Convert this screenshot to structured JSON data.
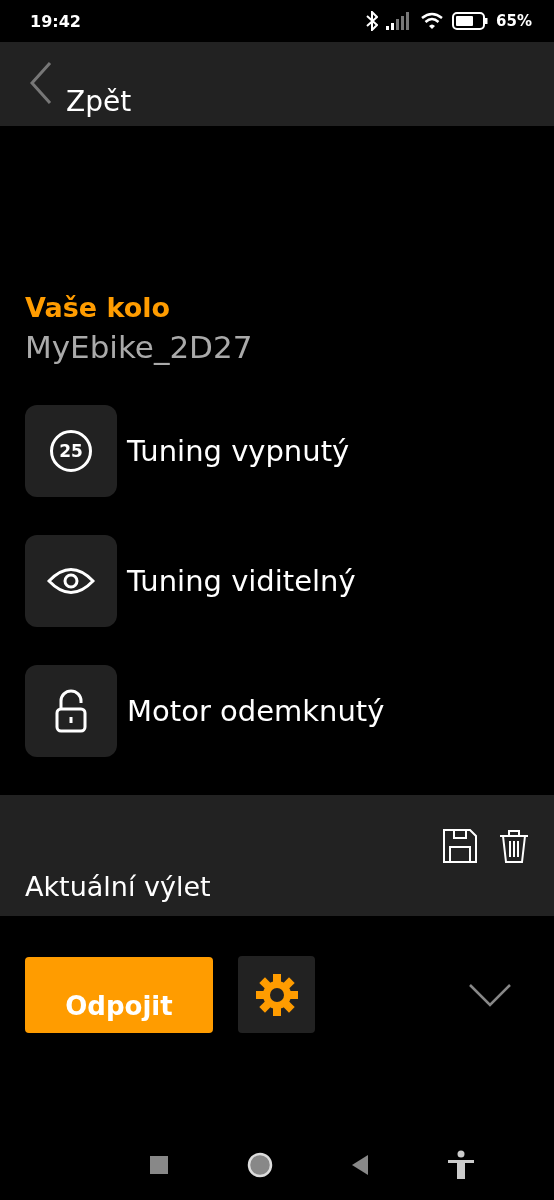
{
  "status_bar": {
    "time": "19:42",
    "battery": "65%"
  },
  "header": {
    "back_label": "Zpět"
  },
  "bike": {
    "heading": "Vaše kolo",
    "name": "MyEbike_2D27"
  },
  "features": [
    {
      "kind": "speed",
      "icon_text": "25",
      "label": "Tuning vypnutý"
    },
    {
      "kind": "eye",
      "label": "Tuning viditelný"
    },
    {
      "kind": "unlock",
      "label": "Motor odemknutý"
    }
  ],
  "trip": {
    "title": "Aktuální výlet"
  },
  "actions": {
    "disconnect": "Odpojit"
  }
}
